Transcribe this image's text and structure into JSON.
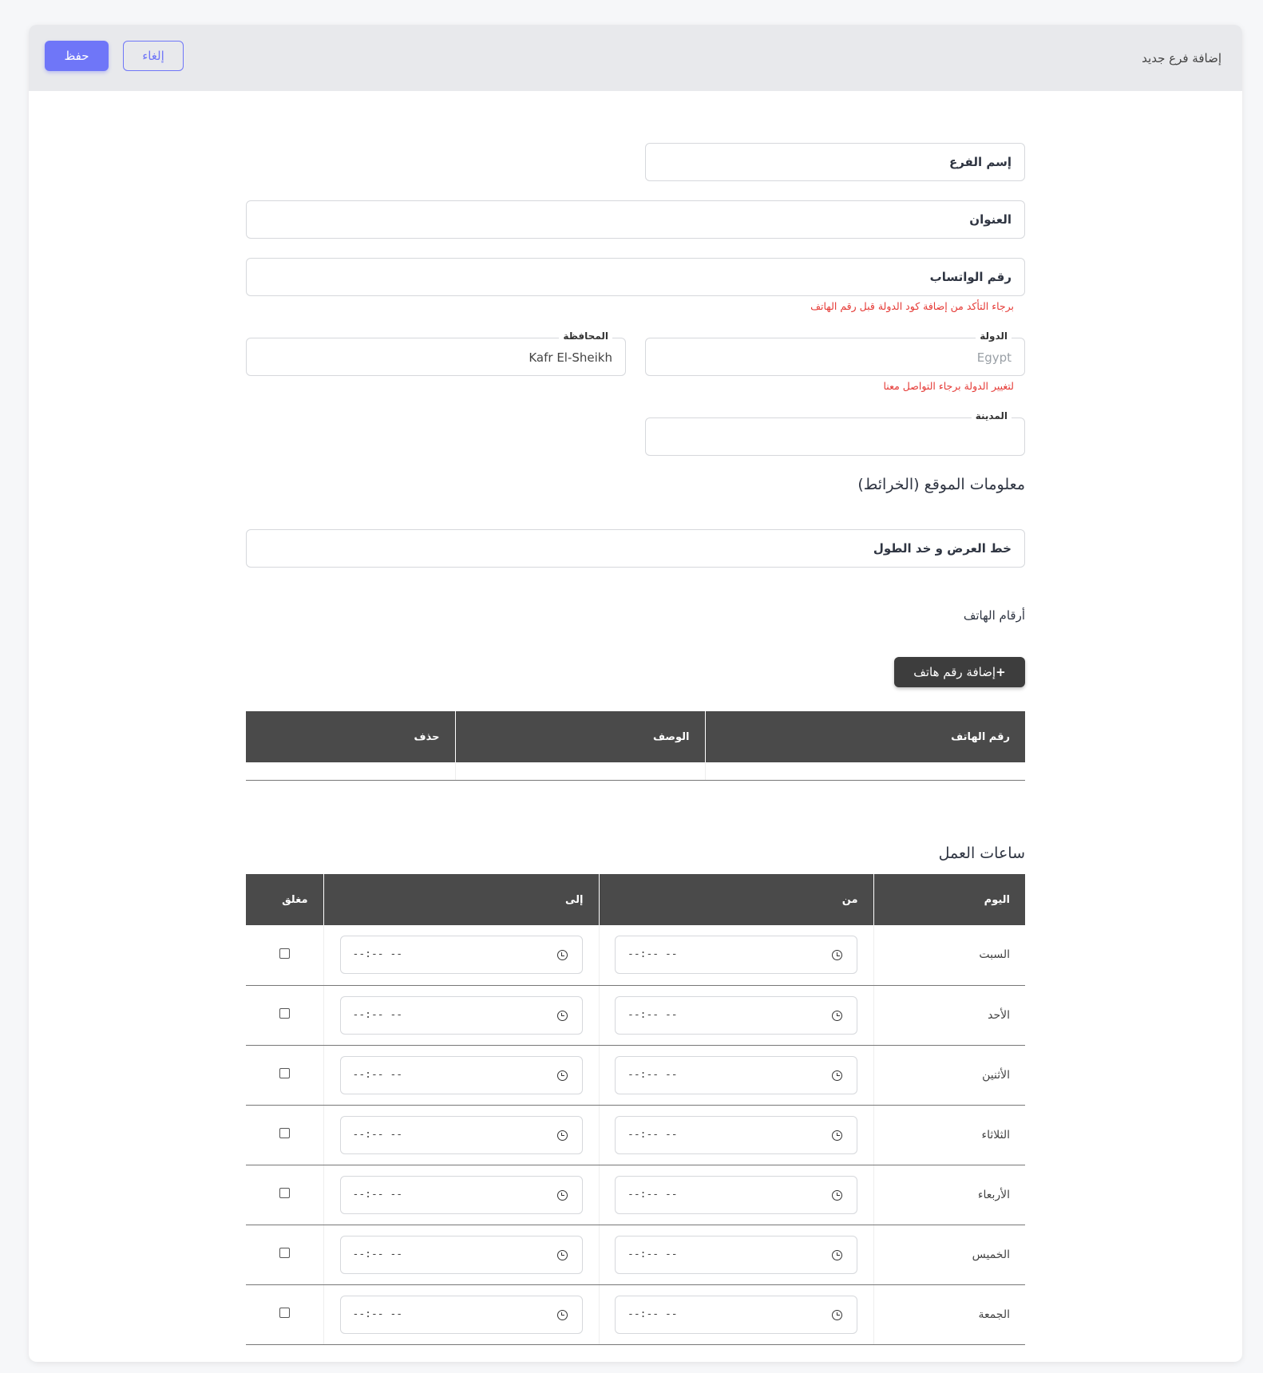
{
  "header": {
    "title": "إضافة فرع جديد",
    "save_label": "حفظ",
    "cancel_label": "إلغاء"
  },
  "form": {
    "branch_name": {
      "placeholder": "إسم الفرع",
      "value": ""
    },
    "address": {
      "placeholder": "العنوان",
      "value": ""
    },
    "whatsapp": {
      "placeholder": "رقم الواتساب",
      "value": ""
    },
    "whatsapp_hint": "برجاء التأكد من إضافة كود الدولة قبل رقم الهاتف",
    "country": {
      "label": "الدولة",
      "value": "Egypt"
    },
    "country_hint": "لتغيير الدولة برجاء التواصل معنا",
    "governorate": {
      "label": "المحافظة",
      "value": "Kafr El-Sheikh"
    },
    "city": {
      "label": "المدينة",
      "value": ""
    }
  },
  "location": {
    "title": "معلومات الموقع (الخرائط)",
    "latlng_placeholder": "خط العرض و خد الطول"
  },
  "phones": {
    "title": "أرقام الهاتف",
    "add_label": "إضافة رقم هاتف",
    "columns": [
      "رقم الهاتف",
      "الوصف",
      "حذف"
    ]
  },
  "hours": {
    "title": "ساعات العمل",
    "columns": [
      "اليوم",
      "من",
      "إلى",
      "مغلق"
    ],
    "time_placeholder": "--:-- --",
    "days": [
      "السبت",
      "الأحد",
      "الأثنين",
      "الثلاثاء",
      "الأربعاء",
      "الخميس",
      "الجمعة"
    ]
  },
  "colors": {
    "accent": "#6f76f8",
    "dark": "#4a4a4a",
    "error": "#e53935"
  }
}
